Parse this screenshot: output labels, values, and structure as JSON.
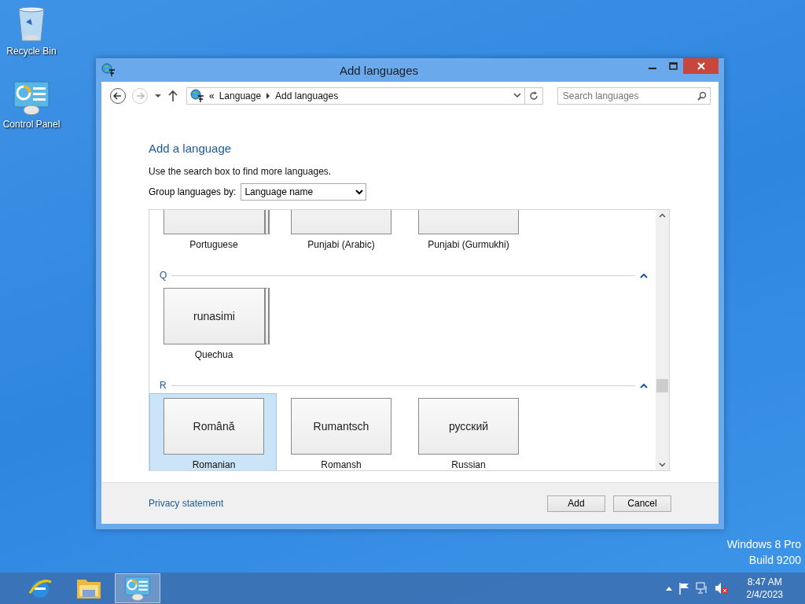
{
  "desktop_icons": [
    {
      "label": "Recycle Bin",
      "kind": "recycle-bin"
    },
    {
      "label": "Control Panel",
      "kind": "control-panel"
    }
  ],
  "window": {
    "title": "Add languages"
  },
  "address_bar": {
    "overflow": "«",
    "crumbs": [
      "Language",
      "Add languages"
    ]
  },
  "search": {
    "placeholder": "Search languages"
  },
  "heading": "Add a language",
  "hint": "Use the search box to find more languages.",
  "group_by": {
    "label": "Group languages by:",
    "value": "Language name"
  },
  "groups": [
    {
      "tiles": [
        {
          "name": "Portuguese",
          "stacked": true,
          "selected": false
        },
        {
          "name": "Punjabi (Arabic)",
          "stacked": false,
          "selected": false
        },
        {
          "name": "Punjabi (Gurmukhi)",
          "stacked": false,
          "selected": false
        }
      ]
    },
    {
      "letter": "Q",
      "tiles": [
        {
          "native": "runasimi",
          "name": "Quechua",
          "stacked": true,
          "selected": false
        }
      ]
    },
    {
      "letter": "R",
      "tiles": [
        {
          "native": "Română",
          "name": "Romanian",
          "stacked": false,
          "selected": true
        },
        {
          "native": "Rumantsch",
          "name": "Romansh",
          "stacked": false,
          "selected": false
        },
        {
          "native": "русский",
          "name": "Russian",
          "stacked": false,
          "selected": false
        }
      ]
    }
  ],
  "footer": {
    "link": "Privacy statement",
    "buttons": [
      "Add",
      "Cancel"
    ]
  },
  "edition": [
    "Windows 8 Pro",
    "Build 9200"
  ],
  "taskbar": {
    "apps": [
      {
        "kind": "browser",
        "active": false
      },
      {
        "kind": "folder",
        "active": false
      },
      {
        "kind": "control-panel",
        "active": true
      }
    ],
    "clock": {
      "time": "8:47 AM",
      "date": "2/4/2023"
    }
  }
}
